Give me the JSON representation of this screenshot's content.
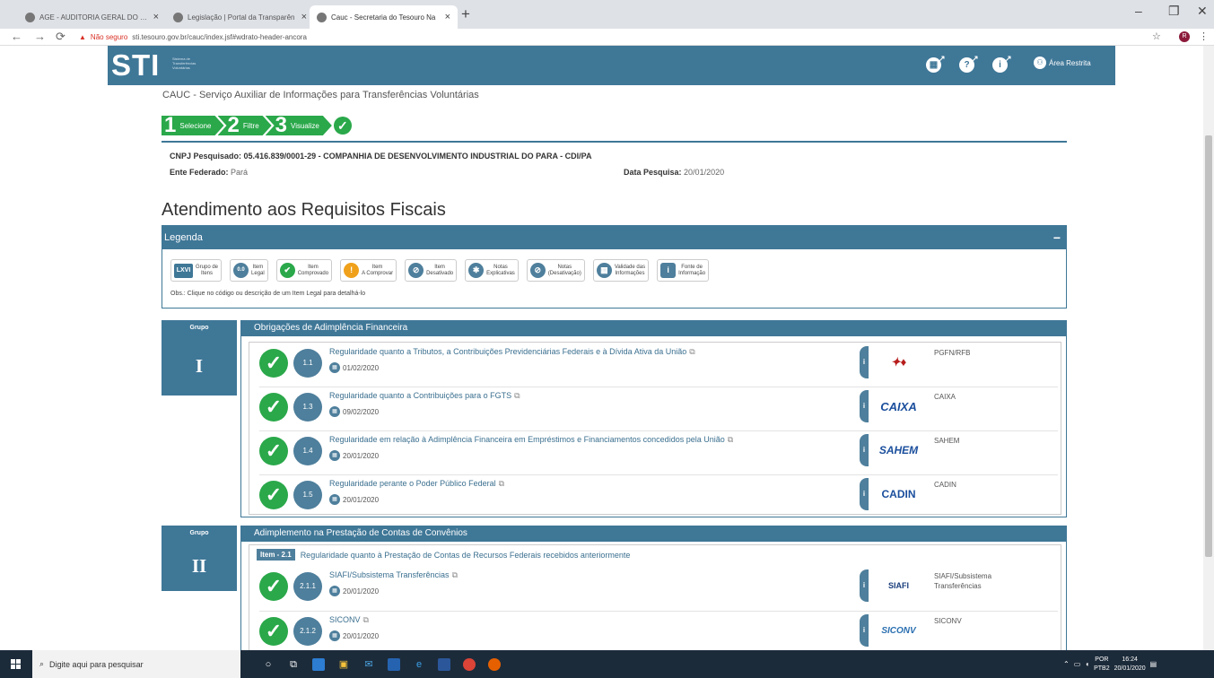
{
  "browser": {
    "tabs": [
      {
        "title": "AGE - AUDITORIA GERAL DO ES"
      },
      {
        "title": "Legislação | Portal da Transparên"
      },
      {
        "title": "Cauc - Secretaria do Tesouro Na"
      }
    ],
    "url_warning": "Não seguro",
    "url": "sti.tesouro.gov.br/cauc/index.jsf#wdrato-header-ancora",
    "profile_initial": "R"
  },
  "header": {
    "logo": "STI",
    "logo_sub": "Sistema de Transferências Voluntárias",
    "area_restrita": "Área Restrita"
  },
  "page": {
    "system_title": "CAUC - Serviço Auxiliar de Informações para Transferências Voluntárias",
    "wizard": [
      {
        "num": "1",
        "label": "Selecione"
      },
      {
        "num": "2",
        "label": "Filtre"
      },
      {
        "num": "3",
        "label": "Visualize"
      }
    ],
    "cnpj_label": "CNPJ Pesquisado:",
    "cnpj_value": "05.416.839/0001-29 - COMPANHIA DE DESENVOLVIMENTO INDUSTRIAL DO PARA - CDI/PA",
    "ente_label": "Ente Federado:",
    "ente_value": "Pará",
    "data_label": "Data Pesquisa:",
    "data_value": "20/01/2020",
    "heading": "Atendimento aos Requisitos Fiscais"
  },
  "legend": {
    "title": "Legenda",
    "collapse": "−",
    "items": [
      {
        "icon": "LXVI",
        "label1": "Grupo de",
        "label2": "Itens"
      },
      {
        "icon": "0.0",
        "label1": "Item",
        "label2": "Legal"
      },
      {
        "icon": "✔",
        "label1": "Item",
        "label2": "Comprovado"
      },
      {
        "icon": "!",
        "label1": "Item",
        "label2": "A Comprovar"
      },
      {
        "icon": "⊘",
        "label1": "Item",
        "label2": "Desativado"
      },
      {
        "icon": "✱",
        "label1": "Notas",
        "label2": "Explicativas"
      },
      {
        "icon": "⊘",
        "label1": "Notas",
        "label2": "(Desativação)"
      },
      {
        "icon": "▦",
        "label1": "Validade das",
        "label2": "Informações"
      },
      {
        "icon": "i",
        "label1": "Fonte de",
        "label2": "Informação"
      }
    ],
    "obs": "Obs.: Clique no código ou descrição de um Item Legal para detalhá-lo"
  },
  "groups": [
    {
      "label": "Grupo",
      "numeral": "I",
      "title": "Obrigações de Adimplência Financeira",
      "rows": [
        {
          "code": "1.1",
          "name": "Regularidade quanto a Tributos, a Contribuições Previdenciárias Federais e à Dívida Ativa da União",
          "date": "01/02/2020",
          "source": "PGFN/RFB",
          "logo": "✦♦"
        },
        {
          "code": "1.3",
          "name": "Regularidade quanto a Contribuições para o FGTS",
          "date": "09/02/2020",
          "source": "CAIXA",
          "logo": "CAIXA"
        },
        {
          "code": "1.4",
          "name": "Regularidade em relação à Adimplência Financeira em Empréstimos e Financiamentos concedidos pela União",
          "date": "20/01/2020",
          "source": "SAHEM",
          "logo": "SAHEM"
        },
        {
          "code": "1.5",
          "name": "Regularidade perante o Poder Público Federal",
          "date": "20/01/2020",
          "source": "CADIN",
          "logo": "CADIN"
        }
      ]
    },
    {
      "label": "Grupo",
      "numeral": "II",
      "title": "Adimplemento na Prestação de Contas de Convênios",
      "item_tag": "Item - 2.1",
      "item_desc": "Regularidade quanto à Prestação de Contas de Recursos Federais recebidos anteriormente",
      "rows": [
        {
          "code": "2.1.1",
          "name": "SIAFI/Subsistema Transferências",
          "date": "20/01/2020",
          "source1": "SIAFI/Subsistema",
          "source2": "Transferências",
          "logo": "SIAFI"
        },
        {
          "code": "2.1.2",
          "name": "SICONV",
          "date": "20/01/2020",
          "source": "SICONV",
          "logo": "SICONV"
        }
      ]
    }
  ],
  "taskbar": {
    "search_placeholder": "Digite aqui para pesquisar",
    "lang": "POR",
    "lang2": "PTB2",
    "time": "16:24",
    "date": "20/01/2020"
  },
  "colors": {
    "primary": "#3f7797",
    "success": "#2aa84a",
    "code_circle": "#4e7f9c"
  }
}
